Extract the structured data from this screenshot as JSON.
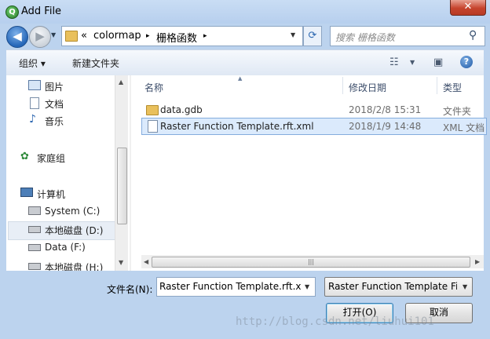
{
  "window": {
    "title": "Add File",
    "title_icon": "Q",
    "close_glyph": "✕"
  },
  "address": {
    "overflow": "«",
    "segments": [
      "colormap",
      "栅格函数"
    ],
    "separator": "▸"
  },
  "search": {
    "placeholder": "搜索 栅格函数"
  },
  "toolbar": {
    "organize": "组织 ▾",
    "new_folder": "新建文件夹"
  },
  "nav_pane": {
    "items": [
      {
        "label": "图片",
        "icon": "pictures-icon"
      },
      {
        "label": "文档",
        "icon": "documents-icon"
      },
      {
        "label": "音乐",
        "icon": "music-icon"
      },
      {
        "label": "家庭组",
        "icon": "homegroup-icon"
      },
      {
        "label": "计算机",
        "icon": "computer-icon"
      },
      {
        "label": "System (C:)",
        "icon": "drive-icon"
      },
      {
        "label": "本地磁盘 (D:)",
        "icon": "drive-icon"
      },
      {
        "label": "Data (F:)",
        "icon": "drive-icon"
      },
      {
        "label": "本地磁盘 (H:)",
        "icon": "drive-icon"
      }
    ],
    "selected_index": 6
  },
  "file_list": {
    "columns": [
      "名称",
      "修改日期",
      "类型"
    ],
    "rows": [
      {
        "name": "data.gdb",
        "modified": "2018/2/8 15:31",
        "type": "文件夹",
        "icon": "folder-icon"
      },
      {
        "name": "Raster Function Template.rft.xml",
        "modified": "2018/1/9 14:48",
        "type": "XML 文档",
        "icon": "xml-file-icon"
      }
    ],
    "selected_row": 1
  },
  "form": {
    "filename_label": "文件名(N):",
    "filename_value": "Raster Function Template.rft.xml",
    "filetype_value": "Raster Function Template Files",
    "open_button": "打开(O)",
    "cancel_button": "取消"
  },
  "watermark": "http://blog.csdn.net/liuhui101"
}
